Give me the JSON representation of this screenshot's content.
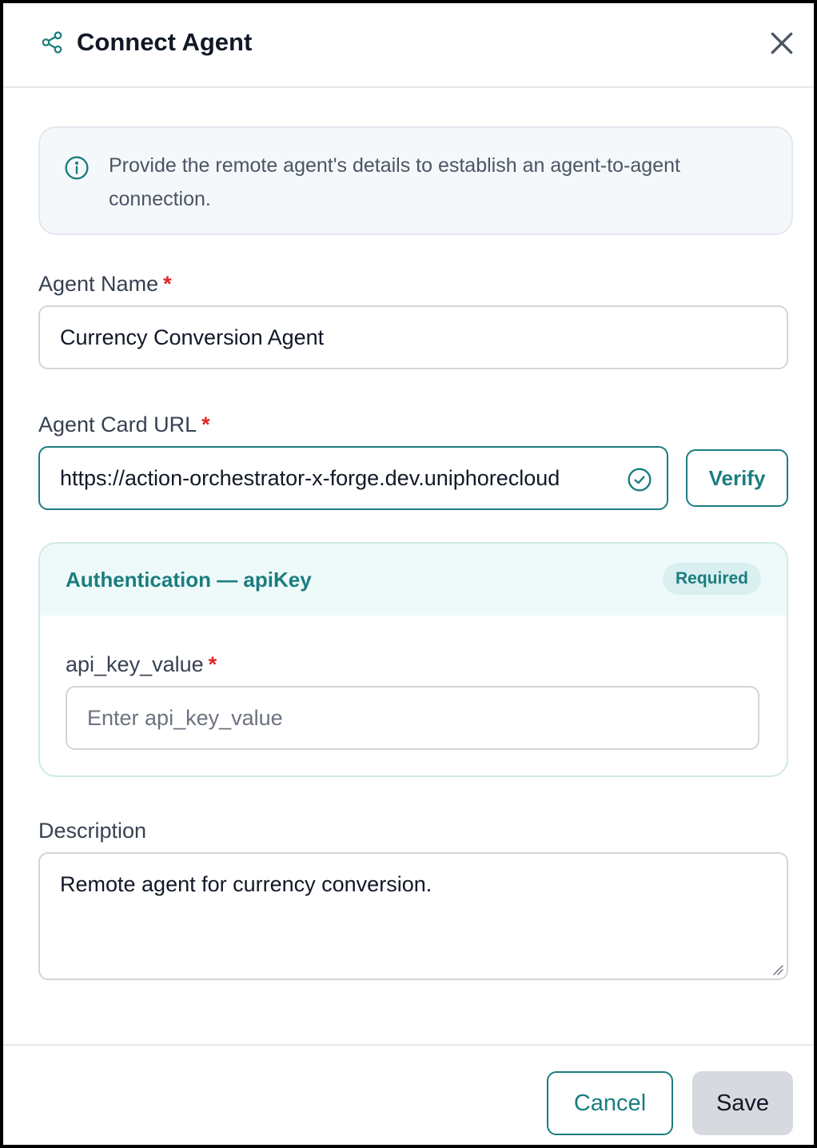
{
  "header": {
    "title": "Connect Agent",
    "icon": "share-icon",
    "close_icon": "close-icon"
  },
  "info": {
    "icon": "info-icon",
    "text": "Provide the remote agent's details to establish an agent-to-agent connection."
  },
  "fields": {
    "agent_name": {
      "label": "Agent Name",
      "required_mark": "*",
      "value": "Currency Conversion Agent"
    },
    "agent_card_url": {
      "label": "Agent Card URL",
      "required_mark": "*",
      "value": "https://action-orchestrator-x-forge.dev.uniphorecloud",
      "status_icon": "check-circle-icon",
      "verify_label": "Verify"
    },
    "description": {
      "label": "Description",
      "value": "Remote agent for currency conversion."
    }
  },
  "auth": {
    "title": "Authentication — apiKey",
    "badge": "Required",
    "field_label": "api_key_value",
    "required_mark": "*",
    "placeholder": "Enter api_key_value",
    "value": ""
  },
  "footer": {
    "cancel_label": "Cancel",
    "save_label": "Save"
  },
  "colors": {
    "accent": "#1b7d7f",
    "required": "#dc2626",
    "save_bg": "#d6d9de"
  }
}
